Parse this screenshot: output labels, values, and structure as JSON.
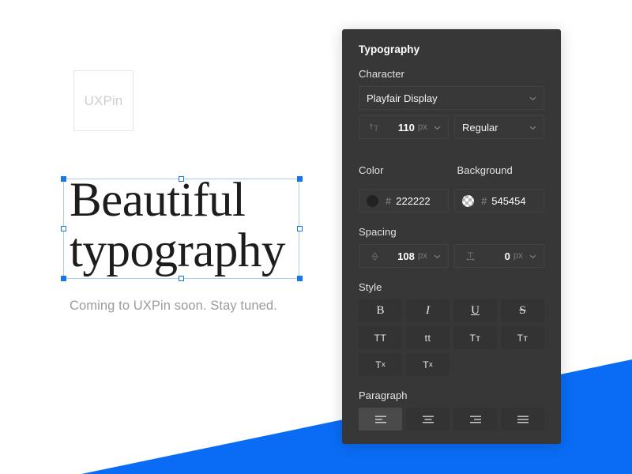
{
  "canvas": {
    "logo_text": "UXPin",
    "headline": "Beautiful\ntypography",
    "caption": "Coming to UXPin soon. Stay tuned.",
    "selection_color": "#1675f0"
  },
  "panel": {
    "title": "Typography",
    "accent": "#0a6cf5",
    "background": "#373737",
    "sections": {
      "character": {
        "label": "Character",
        "font_family": {
          "value": "Playfair Display",
          "icon": "chevron-down-icon"
        },
        "font_size": {
          "icon": "font-size-icon",
          "value": "110",
          "unit": "px",
          "chevron": "chevron-down-icon"
        },
        "font_weight": {
          "value": "Regular",
          "icon": "chevron-down-icon"
        }
      },
      "color": {
        "label": "Color",
        "swatch": "solid-color-swatch",
        "hash": "#",
        "hex": "222222"
      },
      "background": {
        "label": "Background",
        "swatch": "transparent-checker-swatch",
        "hash": "#",
        "hex": "545454"
      },
      "spacing": {
        "label": "Spacing",
        "line_height": {
          "icon": "line-height-icon",
          "value": "108",
          "unit": "px",
          "chevron": "chevron-down-icon"
        },
        "letter_spacing": {
          "icon": "letter-spacing-icon",
          "value": "0",
          "unit": "px",
          "chevron": "chevron-down-icon"
        }
      },
      "style": {
        "label": "Style",
        "buttons": [
          {
            "name": "bold",
            "label": "B",
            "style": "serif",
            "active": false
          },
          {
            "name": "italic",
            "label": "I",
            "style": "serif it",
            "active": false
          },
          {
            "name": "underline",
            "label": "U",
            "style": "serif un",
            "active": false
          },
          {
            "name": "strikethrough",
            "label": "S",
            "style": "serif st",
            "active": false
          },
          {
            "name": "uppercase",
            "label": "TT",
            "style": "caps",
            "active": false
          },
          {
            "name": "lowercase",
            "label": "tt",
            "style": "caps",
            "active": false
          },
          {
            "name": "small-caps",
            "label": "Tт",
            "style": "caps",
            "active": false
          },
          {
            "name": "capitalize",
            "label": "Tт",
            "style": "caps",
            "active": false
          },
          {
            "name": "subscript",
            "label": "T",
            "affix": "x",
            "affix_pos": "sub",
            "active": false
          },
          {
            "name": "superscript",
            "label": "T",
            "affix": "x",
            "affix_pos": "sup",
            "active": false
          }
        ]
      },
      "paragraph": {
        "label": "Paragraph",
        "buttons": [
          {
            "name": "align-left",
            "icon": "align-left-icon",
            "active": true
          },
          {
            "name": "align-center",
            "icon": "align-center-icon",
            "active": false
          },
          {
            "name": "align-right",
            "icon": "align-right-icon",
            "active": false
          },
          {
            "name": "align-justify",
            "icon": "align-justify-icon",
            "active": false
          }
        ]
      }
    }
  }
}
